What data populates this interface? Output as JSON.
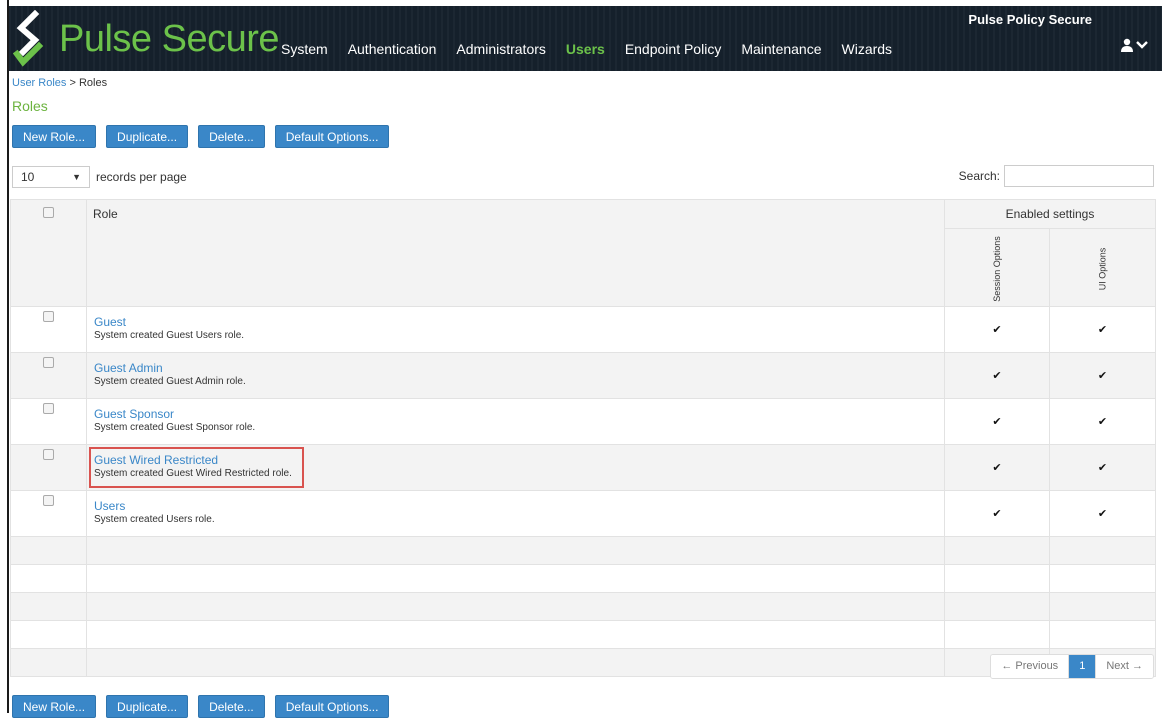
{
  "header": {
    "brand": "Pulse Secure",
    "product": "Pulse Policy Secure",
    "nav": [
      "System",
      "Authentication",
      "Administrators",
      "Users",
      "Endpoint Policy",
      "Maintenance",
      "Wizards"
    ],
    "active_nav": "Users",
    "user_icon": "user-icon"
  },
  "breadcrumb": {
    "parent": "User Roles",
    "separator": " > ",
    "current": "Roles"
  },
  "page_title": "Roles",
  "toolbar": {
    "new": "New Role...",
    "duplicate": "Duplicate...",
    "delete": "Delete...",
    "defaults": "Default Options..."
  },
  "records": {
    "value": "10",
    "label": "records per page"
  },
  "search": {
    "label": "Search:",
    "value": ""
  },
  "table": {
    "col_role": "Role",
    "col_enabled": "Enabled settings",
    "col_session": "Session Options",
    "col_ui": "UI Options",
    "rows": [
      {
        "name": "Guest",
        "desc": "System created Guest Users role.",
        "session": "✔",
        "ui": "✔"
      },
      {
        "name": "Guest Admin",
        "desc": "System created Guest Admin role.",
        "session": "✔",
        "ui": "✔"
      },
      {
        "name": "Guest Sponsor",
        "desc": "System created Guest Sponsor role.",
        "session": "✔",
        "ui": "✔"
      },
      {
        "name": "Guest Wired Restricted",
        "desc": "System created Guest Wired Restricted role.",
        "session": "✔",
        "ui": "✔"
      },
      {
        "name": "Users",
        "desc": "System created Users role.",
        "session": "✔",
        "ui": "✔"
      }
    ]
  },
  "pagination": {
    "prev": "← Previous",
    "page": "1",
    "next": "Next →"
  },
  "colors": {
    "accent": "#3a87c8",
    "green": "#6cc24a",
    "header_bg": "#15202b",
    "highlight": "#d9534f"
  }
}
